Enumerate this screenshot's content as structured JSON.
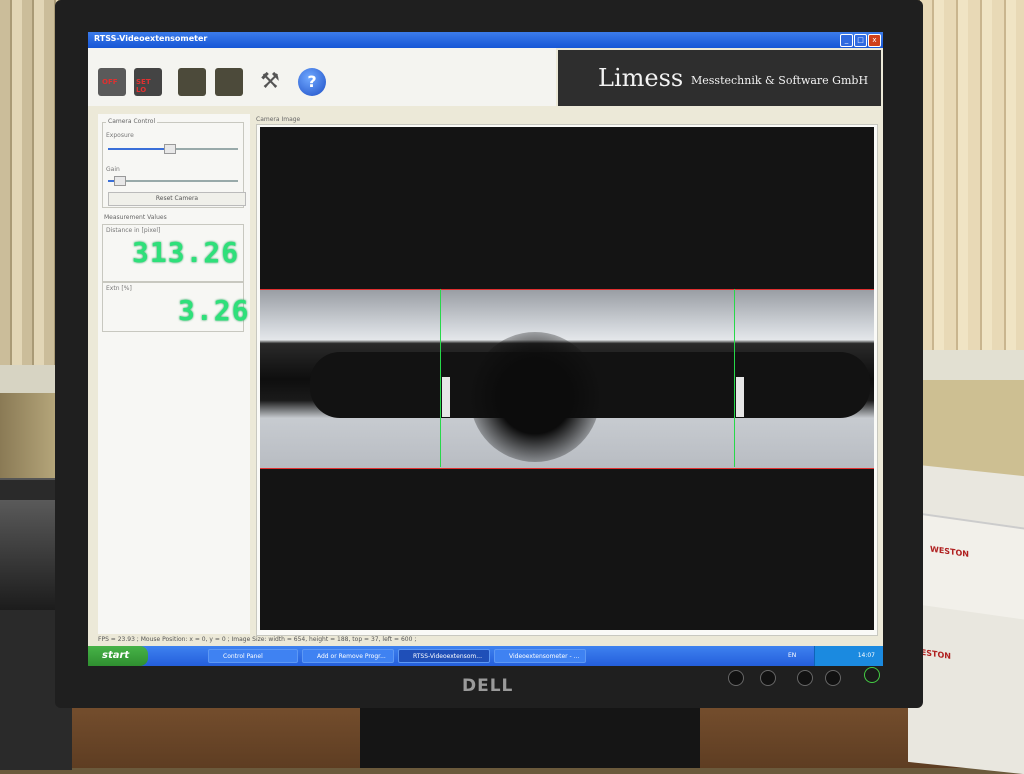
{
  "window": {
    "title": "RTSS-Videoextensometer",
    "min": "_",
    "max": "□",
    "close": "x"
  },
  "toolbar": {
    "off_label": "OFF",
    "setlo_label": "SET LO",
    "help_label": "?"
  },
  "banner": {
    "name": "Limess",
    "subtitle": "Messtechnik & Software GmbH"
  },
  "camera_control": {
    "title": "Camera Control",
    "exposure_label": "Exposure",
    "exposure_level": 0.55,
    "gain_label": "Gain",
    "gain_level": 0.12,
    "reset_button": "Reset Camera"
  },
  "measurement": {
    "title": "Measurement Values",
    "distance_label": "Distance in [pixel]",
    "distance_value": "313.26",
    "strain_label": "Extn [%]",
    "strain_value": "3.26"
  },
  "camera_image": {
    "title": "Camera Image"
  },
  "statusbar": {
    "text": "FPS = 23.93 ; Mouse Position: x = 0, y = 0 ; Image Size: width = 654, height = 188, top = 37, left = 600 ;"
  },
  "taskbar": {
    "start": "start",
    "tasks": [
      "Control Panel",
      "Add or Remove Progr...",
      "RTSS-Videoextensom...",
      "Videoextensometer - ..."
    ],
    "lang": "EN",
    "time": "14:07"
  },
  "monitor": {
    "brand": "DELL"
  },
  "papers": {
    "label": "WESTON"
  },
  "colors": {
    "lcd": "#2ee07a",
    "roi_lines": "#e03030",
    "gauge_lines": "#27d84a",
    "xp_blue": "#245edb"
  }
}
